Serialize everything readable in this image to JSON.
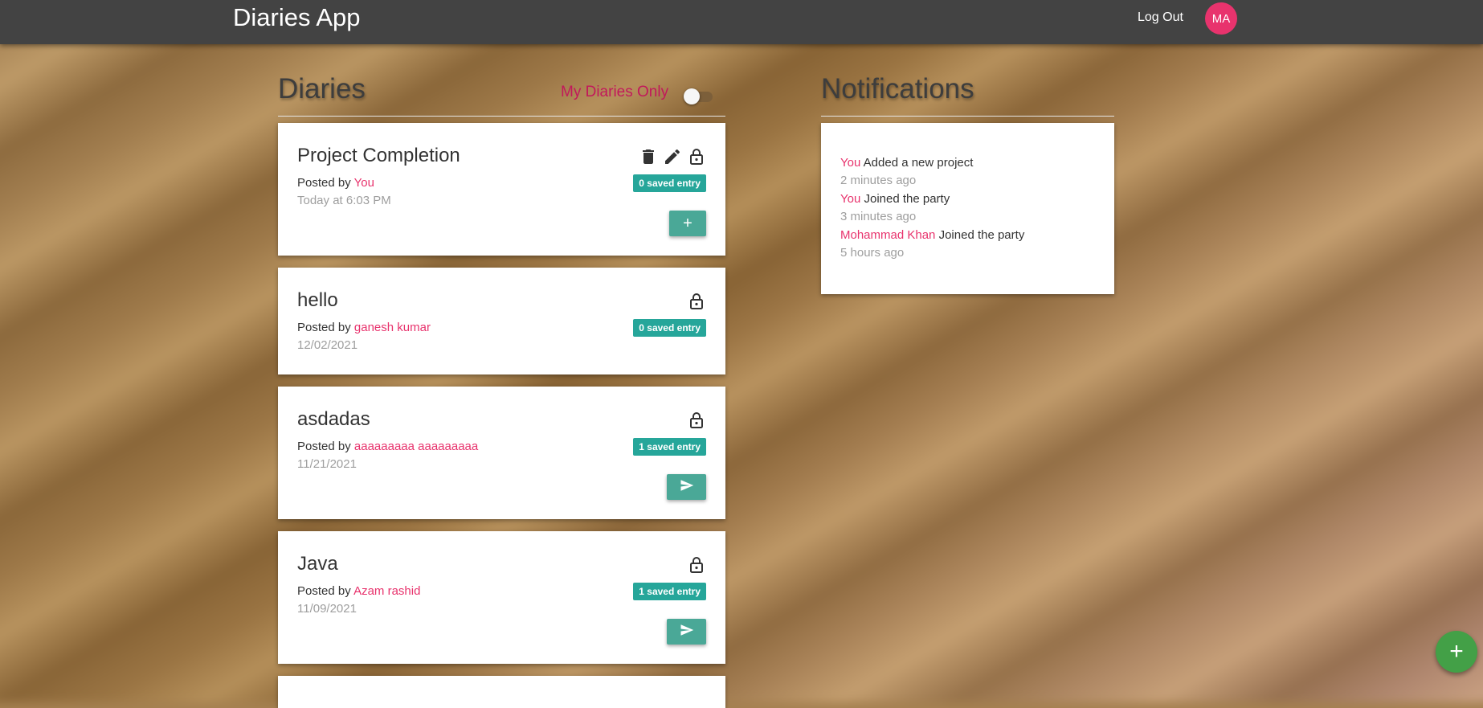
{
  "header": {
    "title": "Diaries App",
    "logout_label": "Log Out",
    "avatar_initials": "MA"
  },
  "diaries_section": {
    "heading": "Diaries",
    "toggle_label": "My Diaries Only",
    "toggle_on": false
  },
  "diaries": [
    {
      "title": "Project Completion",
      "posted_by_label": "Posted by",
      "author": "You",
      "date": "Today at 6:03 PM",
      "badge": "0 saved entry",
      "actions": [
        "trash-icon",
        "pencil-icon",
        "lock-open-icon"
      ],
      "button_icon": "plus-icon",
      "button_text": "+"
    },
    {
      "title": "hello",
      "posted_by_label": "Posted by",
      "author": "ganesh kumar",
      "date": "12/02/2021",
      "badge": "0 saved entry",
      "actions": [
        "lock-open-icon"
      ]
    },
    {
      "title": "asdadas",
      "posted_by_label": "Posted by",
      "author": "aaaaaaaaa aaaaaaaaa",
      "date": "11/21/2021",
      "badge": "1 saved entry",
      "actions": [
        "lock-open-icon"
      ],
      "button_icon": "send-icon"
    },
    {
      "title": "Java",
      "posted_by_label": "Posted by",
      "author": "Azam rashid",
      "date": "11/09/2021",
      "badge": "1 saved entry",
      "actions": [
        "lock-open-icon"
      ],
      "button_icon": "send-icon"
    }
  ],
  "notifications_section": {
    "heading": "Notifications",
    "items": [
      {
        "who": "You",
        "text": "Added a new project",
        "time": "2 minutes ago"
      },
      {
        "who": "You",
        "text": "Joined the party",
        "time": "3 minutes ago"
      },
      {
        "who": "Mohammad Khan",
        "text": "Joined the party",
        "time": "5 hours ago"
      }
    ]
  },
  "fab": {
    "icon": "plus-icon",
    "label": "+"
  },
  "colors": {
    "topbar": "#434343",
    "accent_pink": "#e8336d",
    "badge_teal": "#26a69a",
    "button_teal": "#4aa897",
    "fab_green": "#43a047"
  }
}
